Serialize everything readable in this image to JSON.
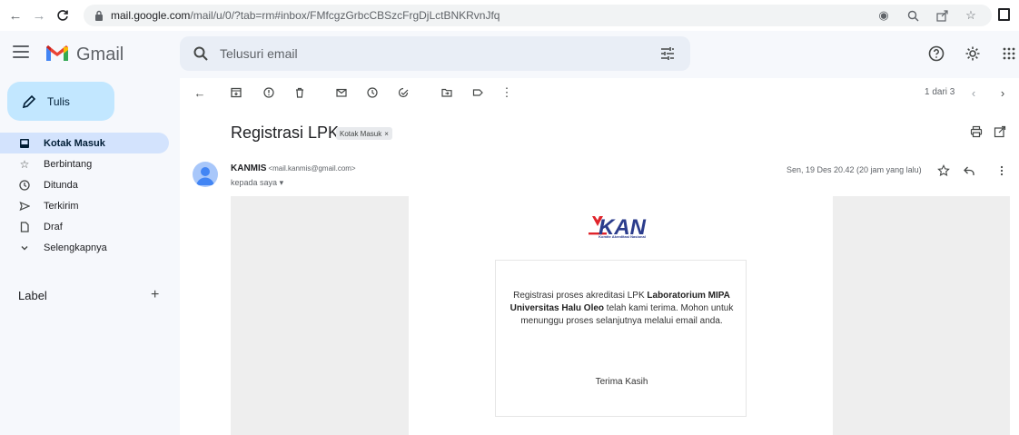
{
  "browser": {
    "url_host": "mail.google.com",
    "url_path": "/mail/u/0/?tab=rm#inbox/FMfcgzGrbcCBSzcFrgDjLctBNKRvnJfq"
  },
  "header": {
    "app_name": "Gmail",
    "search_placeholder": "Telusuri email"
  },
  "sidebar": {
    "compose_label": "Tulis",
    "items": [
      {
        "label": "Kotak Masuk",
        "icon": "inbox-icon",
        "active": true
      },
      {
        "label": "Berbintang",
        "icon": "star-icon"
      },
      {
        "label": "Ditunda",
        "icon": "clock-icon"
      },
      {
        "label": "Terkirim",
        "icon": "send-icon"
      },
      {
        "label": "Draf",
        "icon": "draft-icon"
      },
      {
        "label": "Selengkapnya",
        "icon": "chevron-down-icon"
      }
    ],
    "label_heading": "Label",
    "label_add": "+"
  },
  "toolbar": {
    "page_count": "1 dari 3"
  },
  "email": {
    "subject": "Registrasi LPK",
    "label_chip": "Kotak Masuk",
    "label_chip_close": "×",
    "sender_name": "KANMIS",
    "sender_email": "<mail.kanmis@gmail.com>",
    "to_line": "kepada saya",
    "date": "Sen, 19 Des 20.42 (20 jam yang lalu)"
  },
  "body": {
    "logo_text": "KAN",
    "logo_subtitle": "Komite Akreditasi Nasional",
    "msg_part1": "Registrasi proses akreditasi LPK ",
    "msg_bold": "Laboratorium MIPA Universitas Halu Oleo",
    "msg_part2": " telah kami terima. Mohon untuk menunggu proses selanjutnya melalui email anda.",
    "thanks": "Terima Kasih"
  },
  "colors": {
    "compose_bg": "#c2e7ff",
    "active_item_bg": "#d3e3fd",
    "app_bg": "#f6f8fc",
    "search_bg": "#e9eef6",
    "kan_red": "#e0242b",
    "kan_blue": "#2b3c8c"
  }
}
